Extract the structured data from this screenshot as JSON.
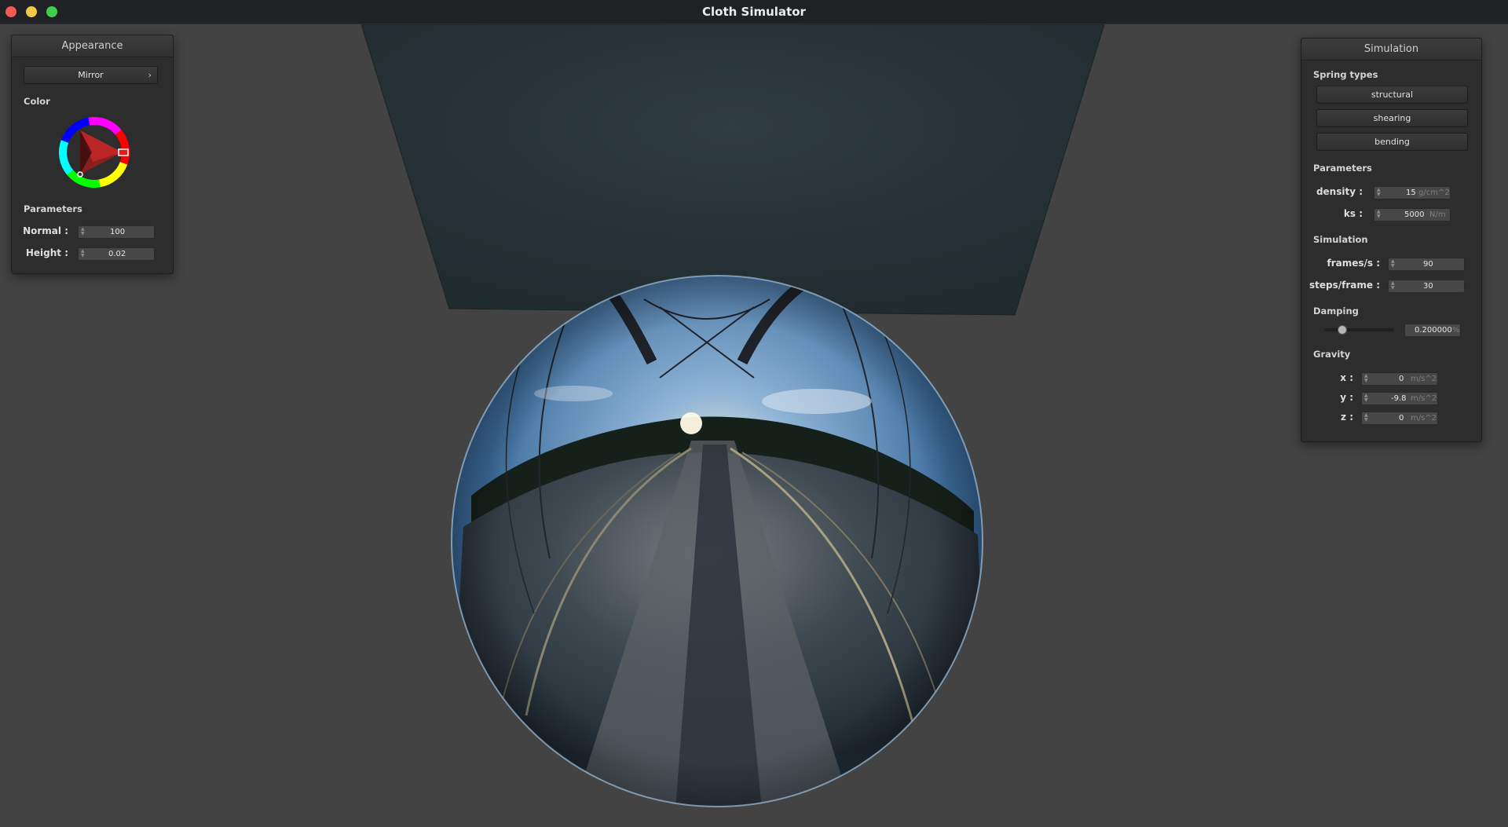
{
  "window": {
    "title": "Cloth Simulator"
  },
  "appearance": {
    "title": "Appearance",
    "shader_select": "Mirror",
    "color_label": "Color",
    "parameters_label": "Parameters",
    "normal_label": "Normal :",
    "normal_value": "100",
    "height_label": "Height :",
    "height_value": "0.02"
  },
  "simulation": {
    "title": "Simulation",
    "spring_types_label": "Spring types",
    "spring_buttons": [
      "structural",
      "shearing",
      "bending"
    ],
    "parameters_label": "Parameters",
    "density_label": "density :",
    "density_value": "15",
    "density_unit": "g/cm^2",
    "ks_label": "ks :",
    "ks_value": "5000",
    "ks_unit": "N/m",
    "simulation_label": "Simulation",
    "fps_label": "frames/s :",
    "fps_value": "90",
    "steps_label": "steps/frame :",
    "steps_value": "30",
    "damping_label": "Damping",
    "damping_value": "0.200000",
    "damping_unit": "%",
    "damping_fraction": 0.2,
    "gravity_label": "Gravity",
    "gx_label": "x :",
    "gx_value": "0",
    "gy_label": "y :",
    "gy_value": "-9.8",
    "gz_label": "z :",
    "gz_value": "0",
    "gravity_unit": "m/s^2"
  },
  "colors": {
    "background": "#434343",
    "cloth": "#283438",
    "panel": "#2d2d2d",
    "selected_color": "#e11d1d"
  },
  "icons": [
    "close-icon",
    "minimize-icon",
    "maximize-icon",
    "chevron-right-icon",
    "spin-arrows-icon"
  ]
}
